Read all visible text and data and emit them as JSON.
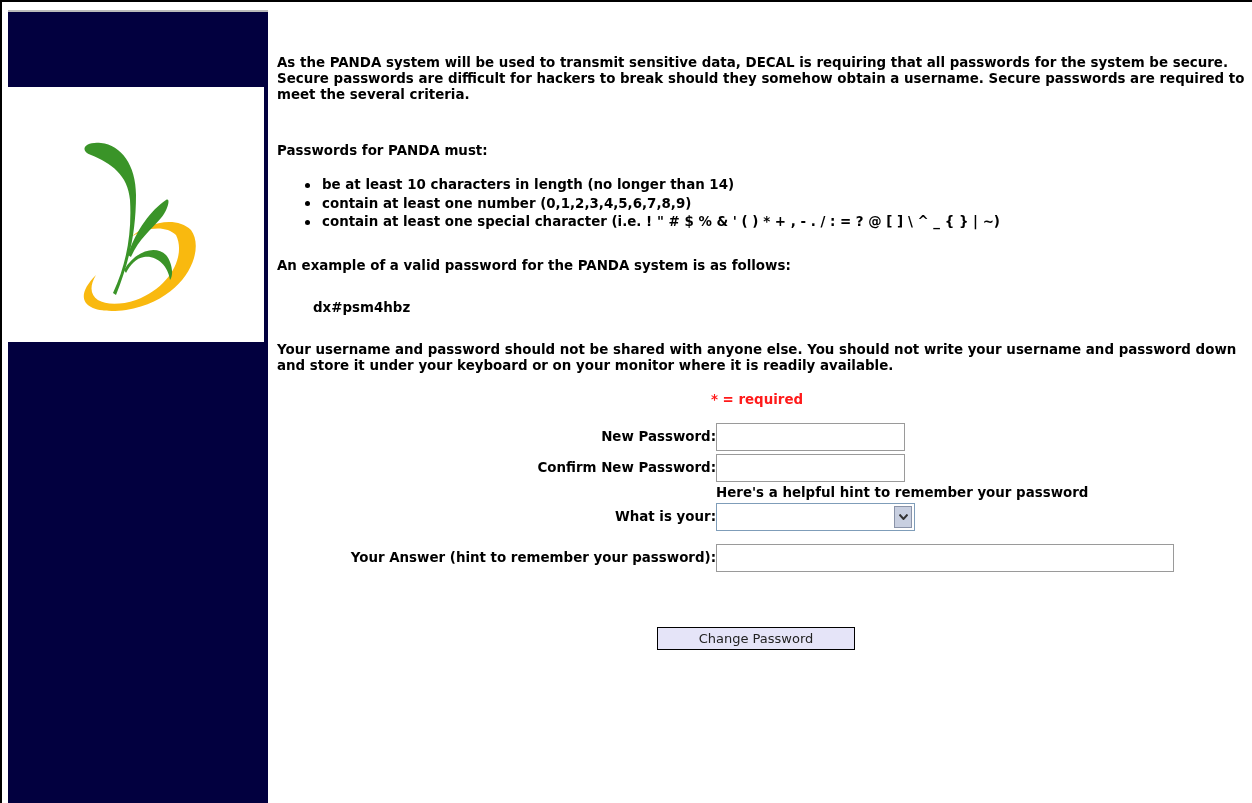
{
  "intro": "As the PANDA system will be used to transmit sensitive data, DECAL is requiring that all passwords for the system be secure. Secure passwords are difficult for hackers to break should they somehow obtain a username. Secure passwords are required to meet the several criteria.",
  "rules_heading": "Passwords for PANDA must:",
  "rules": [
    "be at least 10 characters in length (no longer than 14)",
    "contain at least one number (0,1,2,3,4,5,6,7,8,9)",
    "contain at least one special character (i.e. ! \" # $ % & ' ( ) * + , - . / : = ? @ [ ] \\ ^ _ { } | ~)"
  ],
  "example_intro": "An example of a valid password for the PANDA system is as follows:",
  "example": "dx#psm4hbz",
  "warning": "Your username and password should not be shared with anyone else. You should not write your username and password down and store it under your keyboard or on your monitor where it is readily available.",
  "required_note": "* = required",
  "form": {
    "new_password": {
      "label": "New Password:"
    },
    "confirm_password": {
      "label": "Confirm New Password:"
    },
    "hint_note": "Here's a helpful hint to remember your password",
    "question": {
      "label": "What is your:"
    },
    "answer": {
      "label": "Your Answer (hint to remember your password):"
    },
    "submit": "Change Password"
  }
}
